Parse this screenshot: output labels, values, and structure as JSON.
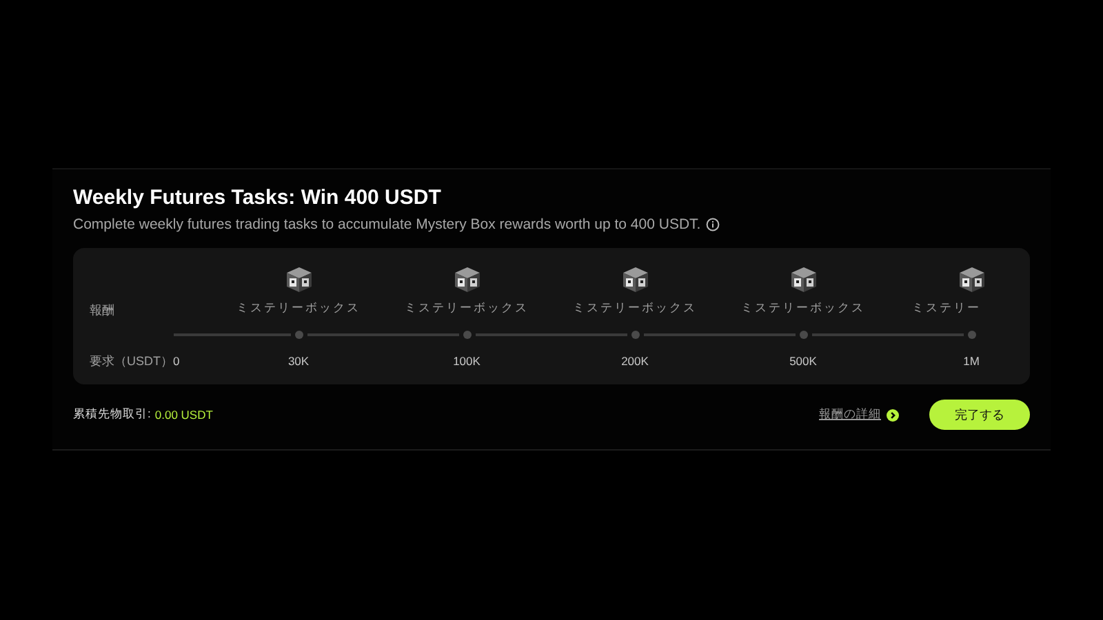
{
  "title": "Weekly Futures Tasks: Win 400 USDT",
  "subtitle": "Complete weekly futures trading tasks to accumulate Mystery Box rewards worth up to 400 USDT.",
  "rows": {
    "reward_label": "報酬",
    "requirement_label": "要求（USDT）"
  },
  "milestones": [
    {
      "requirement": "0"
    },
    {
      "requirement": "30K",
      "reward": "ミステリーボックス"
    },
    {
      "requirement": "100K",
      "reward": "ミステリーボックス"
    },
    {
      "requirement": "200K",
      "reward": "ミステリーボックス"
    },
    {
      "requirement": "500K",
      "reward": "ミステリーボックス"
    },
    {
      "requirement": "1M",
      "reward": "ミステリー"
    }
  ],
  "footer": {
    "volume_label": "累積先物取引:",
    "volume_value": "0.00 USDT",
    "details_link": "報酬の詳細",
    "button": "完了する"
  }
}
